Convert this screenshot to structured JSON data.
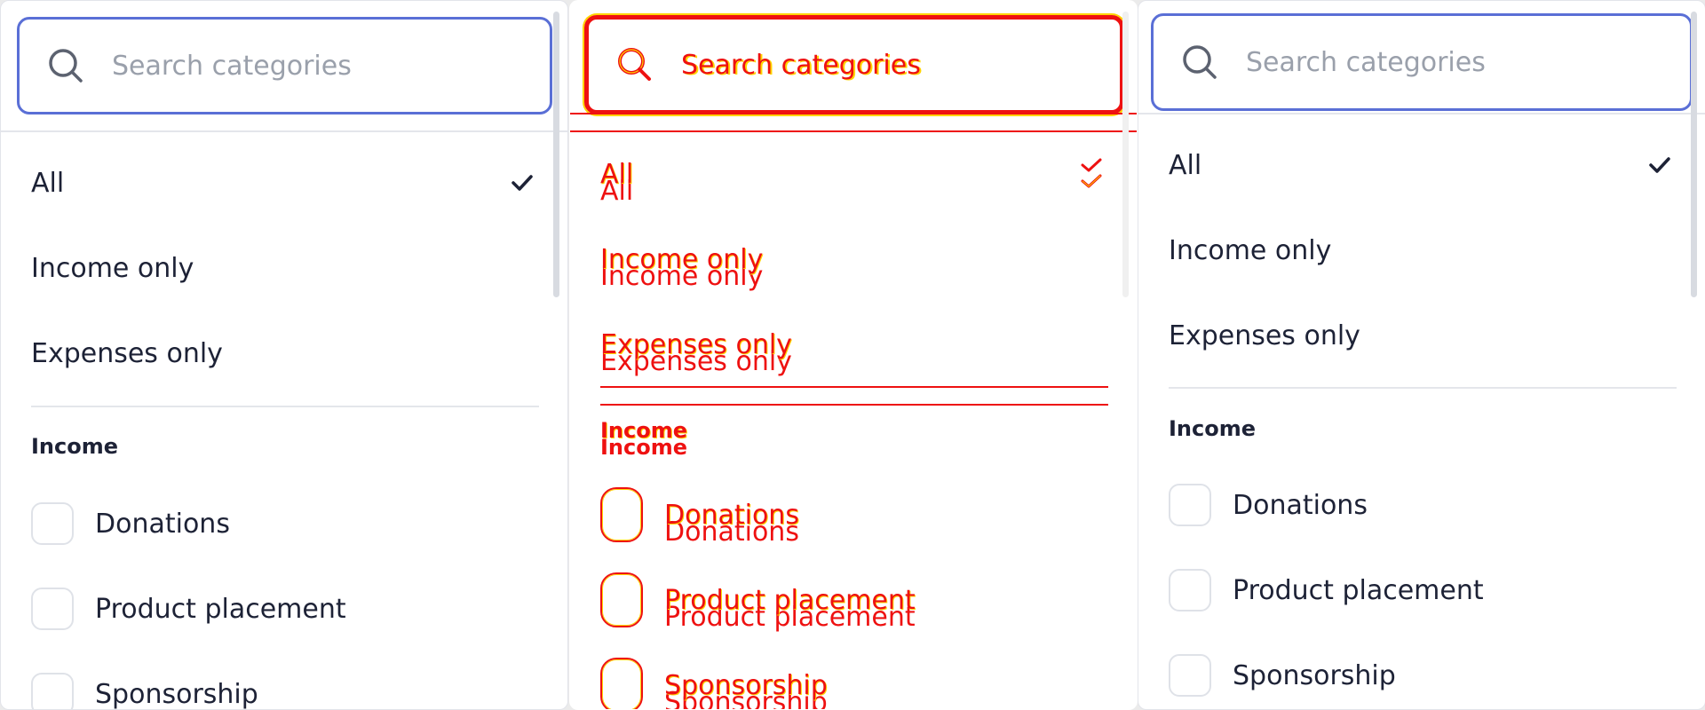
{
  "panels": [
    {
      "search": {
        "placeholder": "Search categories",
        "icon": "search-icon"
      },
      "options": [
        {
          "label": "All",
          "selected": true
        },
        {
          "label": "Income only",
          "selected": false
        },
        {
          "label": "Expenses only",
          "selected": false
        }
      ],
      "section": "Income",
      "categories": [
        {
          "label": "Donations",
          "checked": false
        },
        {
          "label": "Product placement",
          "checked": false
        },
        {
          "label": "Sponsorship",
          "checked": false
        }
      ]
    },
    {
      "search": {
        "placeholder": "Search categories",
        "icon": "search-icon"
      },
      "options": [
        {
          "label": "All",
          "selected": true
        },
        {
          "label": "Income only",
          "selected": false
        },
        {
          "label": "Expenses only",
          "selected": false
        }
      ],
      "section": "Income",
      "categories": [
        {
          "label": "Donations",
          "checked": false
        },
        {
          "label": "Product placement",
          "checked": false
        },
        {
          "label": "Sponsorship",
          "checked": false
        }
      ]
    },
    {
      "search": {
        "placeholder": "Search categories",
        "icon": "search-icon"
      },
      "options": [
        {
          "label": "All",
          "selected": true
        },
        {
          "label": "Income only",
          "selected": false
        },
        {
          "label": "Expenses only",
          "selected": false
        }
      ],
      "section": "Income",
      "categories": [
        {
          "label": "Donations",
          "checked": false
        },
        {
          "label": "Product placement",
          "checked": false
        },
        {
          "label": "Sponsorship",
          "checked": false
        }
      ]
    }
  ],
  "colors": {
    "accent": "#5a6fd6",
    "text": "#1d2236",
    "placeholder": "#9aa0ab",
    "diff_red": "#ee1111",
    "diff_yellow": "#ffd400"
  }
}
